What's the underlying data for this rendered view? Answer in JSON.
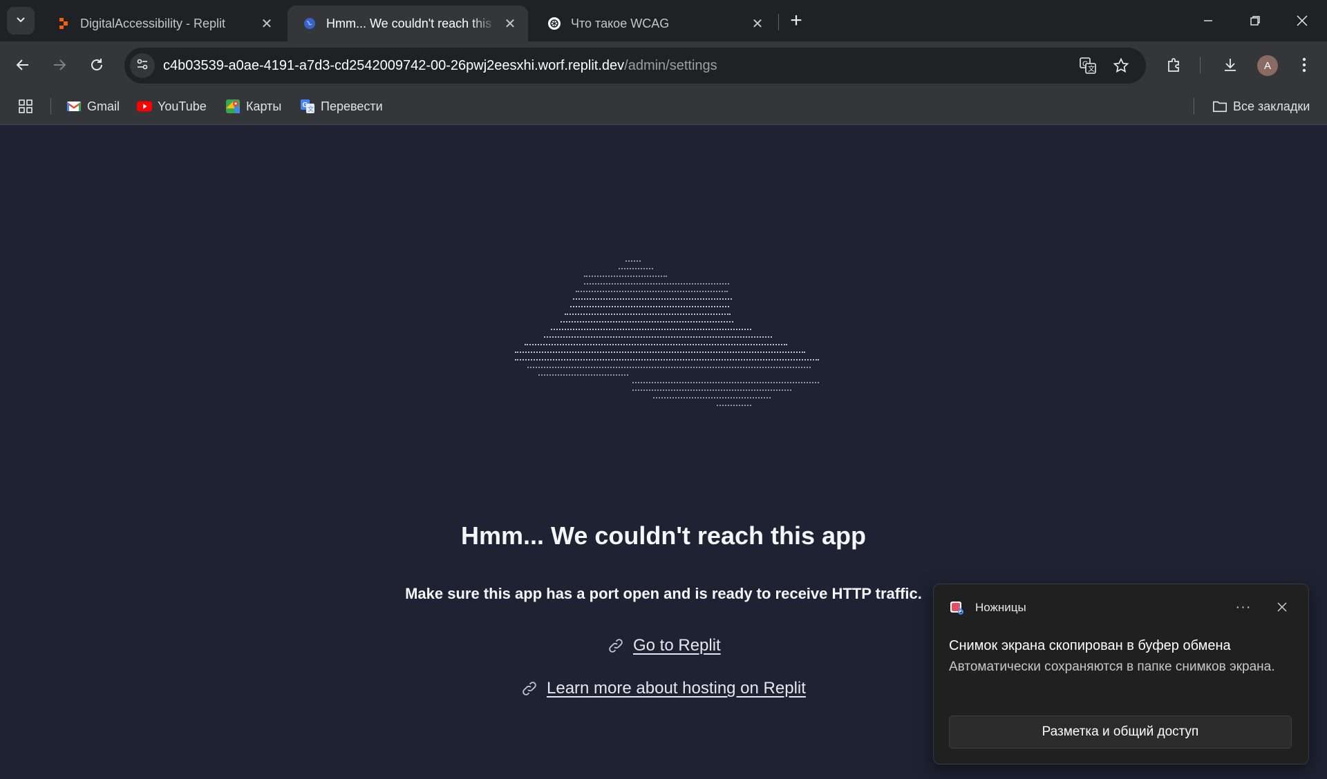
{
  "tabs": [
    {
      "label": "DigitalAccessibility - Replit",
      "icon": "replit-icon",
      "active": false
    },
    {
      "label": "Hmm... We couldn't reach this app",
      "icon": "replit-globe-icon",
      "active": true
    },
    {
      "label": "Что такое WCAG",
      "icon": "chatgpt-icon",
      "active": false
    }
  ],
  "address_bar": {
    "host": "c4b03539-a0ae-4191-a7d3-cd2542009742-00-26pwj2eesxhi.worf.replit.dev",
    "path": "/admin/settings"
  },
  "profile": {
    "initial": "A"
  },
  "bookmarks": {
    "items": [
      {
        "label": "Gmail",
        "icon": "gmail-icon"
      },
      {
        "label": "YouTube",
        "icon": "youtube-icon"
      },
      {
        "label": "Карты",
        "icon": "maps-icon"
      },
      {
        "label": "Перевести",
        "icon": "translate-icon"
      }
    ],
    "all_bookmarks": "Все закладки"
  },
  "page": {
    "headline": "Hmm... We couldn't reach this app",
    "subtext": "Make sure this app has a port open and is ready to receive HTTP traffic.",
    "links": [
      {
        "label": "Go to Replit",
        "icon": "link-icon"
      },
      {
        "label": "Learn more about hosting on Replit",
        "icon": "link-icon"
      }
    ]
  },
  "toast": {
    "app_name": "Ножницы",
    "more": "···",
    "title": "Снимок экрана скопирован в буфер обмена",
    "body": "Автоматически сохраняются в папке снимков экрана.",
    "button": "Разметка и общий доступ"
  },
  "colors": {
    "page_background": "#1f2232",
    "browser_frame": "#202124",
    "toolbar": "#35363a",
    "toast_background": "#202020",
    "youtube_red": "#ff0000"
  }
}
